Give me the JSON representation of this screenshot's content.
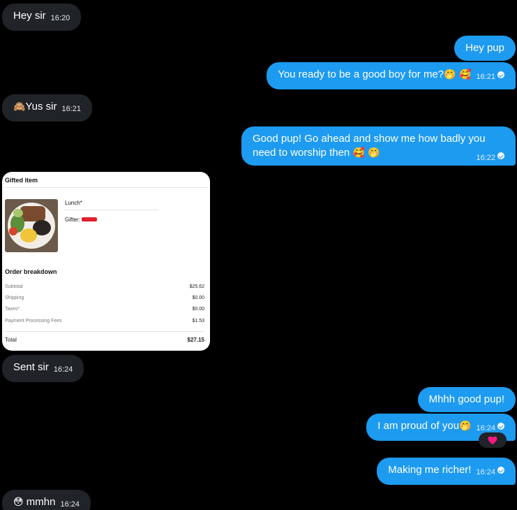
{
  "messages": {
    "m1": {
      "text": "Hey sir",
      "time": "16:20"
    },
    "m2": {
      "text": "Hey pup"
    },
    "m3": {
      "text": "You ready to be a good boy for me?",
      "emoji": "🤭 🥰",
      "time": "16:21"
    },
    "m4": {
      "emoji": "🙈",
      "text": "Yus sir",
      "time": "16:21"
    },
    "m5": {
      "text_line1": "Good pup! Go ahead and show me how badly you",
      "text_line2": "need to worship then",
      "emoji": "🥰 🤭",
      "time": "16:22"
    },
    "m6": {
      "text": "Sent sir",
      "time": "16:24"
    },
    "m7": {
      "text": "Mhhh good pup!"
    },
    "m8": {
      "text": "I am proud of you",
      "emoji": "🤭",
      "time": "16:24"
    },
    "m9": {
      "text": "Making me richer!",
      "time": "16:24"
    },
    "m10": {
      "emoji": "😳",
      "text": "mmhn",
      "time": "16:24"
    }
  },
  "card": {
    "header": "Gifted item",
    "item_name": "Lunch*",
    "gifter_label": "Gifter:",
    "breakdown_title": "Order breakdown",
    "rows": [
      {
        "label": "Subtotal",
        "value": "$25.62"
      },
      {
        "label": "Shipping",
        "value": "$0.00"
      },
      {
        "label": "Taxes*",
        "value": "$0.00"
      },
      {
        "label": "Payment Processing Fees",
        "value": "$1.53"
      }
    ],
    "total_label": "Total",
    "total_value": "$27.15"
  },
  "reaction": {
    "icon": "heart-icon",
    "color": "#f91880"
  },
  "colors": {
    "outgoing": "#1d9bf0",
    "incoming": "#202327",
    "background": "#000000"
  }
}
